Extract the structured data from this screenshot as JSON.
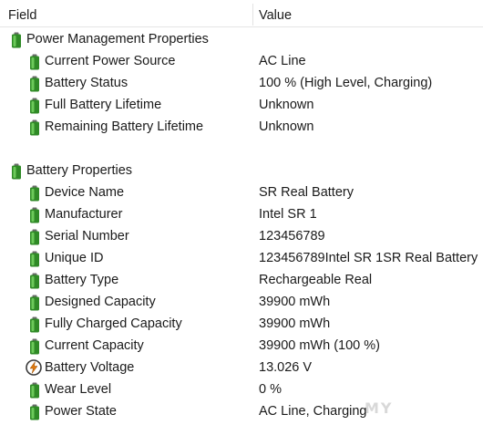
{
  "header": {
    "field_label": "Field",
    "value_label": "Value"
  },
  "rows": [
    {
      "kind": "group",
      "icon": "battery-icon",
      "label": "Power Management Properties",
      "value": ""
    },
    {
      "kind": "item",
      "icon": "battery-icon",
      "label": "Current Power Source",
      "value": "AC Line"
    },
    {
      "kind": "item",
      "icon": "battery-icon",
      "label": "Battery Status",
      "value": "100 % (High Level, Charging)"
    },
    {
      "kind": "item",
      "icon": "battery-icon",
      "label": "Full Battery Lifetime",
      "value": "Unknown"
    },
    {
      "kind": "item",
      "icon": "battery-icon",
      "label": "Remaining Battery Lifetime",
      "value": "Unknown"
    },
    {
      "kind": "group",
      "icon": "battery-icon",
      "label": "Battery Properties",
      "value": ""
    },
    {
      "kind": "item",
      "icon": "battery-icon",
      "label": "Device Name",
      "value": "SR Real Battery"
    },
    {
      "kind": "item",
      "icon": "battery-icon",
      "label": "Manufacturer",
      "value": "Intel SR 1"
    },
    {
      "kind": "item",
      "icon": "battery-icon",
      "label": "Serial Number",
      "value": "123456789"
    },
    {
      "kind": "item",
      "icon": "battery-icon",
      "label": "Unique ID",
      "value": "123456789Intel SR 1SR Real Battery"
    },
    {
      "kind": "item",
      "icon": "battery-icon",
      "label": "Battery Type",
      "value": "Rechargeable Real"
    },
    {
      "kind": "item",
      "icon": "battery-icon",
      "label": "Designed Capacity",
      "value": "39900 mWh"
    },
    {
      "kind": "item",
      "icon": "battery-icon",
      "label": "Fully Charged Capacity",
      "value": "39900 mWh"
    },
    {
      "kind": "item",
      "icon": "battery-icon",
      "label": "Current Capacity",
      "value": "39900 mWh  (100 %)"
    },
    {
      "kind": "item",
      "icon": "voltage-icon",
      "label": "Battery Voltage",
      "value": "13.026 V"
    },
    {
      "kind": "item",
      "icon": "battery-icon",
      "label": "Wear Level",
      "value": "0 %"
    },
    {
      "kind": "item",
      "icon": "battery-icon",
      "label": "Power State",
      "value": "AC Line, Charging"
    }
  ],
  "colors": {
    "battery_green": "#3a9e2f",
    "battery_dark": "#2a7a22",
    "voltage_orange": "#e07a10"
  }
}
